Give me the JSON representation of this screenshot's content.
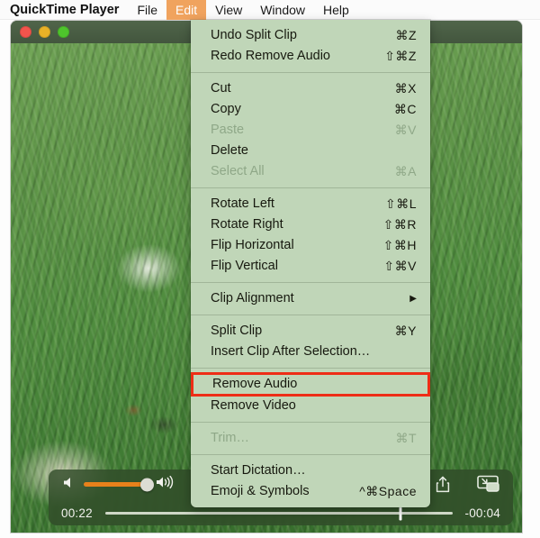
{
  "menubar": {
    "app_name": "QuickTime Player",
    "items": [
      {
        "label": "File",
        "active": false
      },
      {
        "label": "Edit",
        "active": true
      },
      {
        "label": "View",
        "active": false
      },
      {
        "label": "Window",
        "active": false
      },
      {
        "label": "Help",
        "active": false
      }
    ],
    "active_accent": "#f0a35e"
  },
  "window": {
    "traffic_lights": [
      {
        "name": "close",
        "color": "#f2544c"
      },
      {
        "name": "minimize",
        "color": "#e8b227"
      },
      {
        "name": "zoom",
        "color": "#4ec42c"
      }
    ]
  },
  "edit_menu": {
    "highlight_color": "#ee2d16",
    "background": "#c0d6b8",
    "groups": [
      {
        "items": [
          {
            "label": "Undo Split Clip",
            "shortcut": "⌘Z",
            "enabled": true,
            "highlighted": false,
            "submenu": false
          },
          {
            "label": "Redo Remove Audio",
            "shortcut": "⇧⌘Z",
            "enabled": true,
            "highlighted": false,
            "submenu": false
          }
        ]
      },
      {
        "items": [
          {
            "label": "Cut",
            "shortcut": "⌘X",
            "enabled": true,
            "highlighted": false,
            "submenu": false
          },
          {
            "label": "Copy",
            "shortcut": "⌘C",
            "enabled": true,
            "highlighted": false,
            "submenu": false
          },
          {
            "label": "Paste",
            "shortcut": "⌘V",
            "enabled": false,
            "highlighted": false,
            "submenu": false
          },
          {
            "label": "Delete",
            "shortcut": "",
            "enabled": true,
            "highlighted": false,
            "submenu": false
          },
          {
            "label": "Select All",
            "shortcut": "⌘A",
            "enabled": false,
            "highlighted": false,
            "submenu": false
          }
        ]
      },
      {
        "items": [
          {
            "label": "Rotate Left",
            "shortcut": "⇧⌘L",
            "enabled": true,
            "highlighted": false,
            "submenu": false
          },
          {
            "label": "Rotate Right",
            "shortcut": "⇧⌘R",
            "enabled": true,
            "highlighted": false,
            "submenu": false
          },
          {
            "label": "Flip Horizontal",
            "shortcut": "⇧⌘H",
            "enabled": true,
            "highlighted": false,
            "submenu": false
          },
          {
            "label": "Flip Vertical",
            "shortcut": "⇧⌘V",
            "enabled": true,
            "highlighted": false,
            "submenu": false
          }
        ]
      },
      {
        "items": [
          {
            "label": "Clip Alignment",
            "shortcut": "",
            "enabled": true,
            "highlighted": false,
            "submenu": true
          }
        ]
      },
      {
        "items": [
          {
            "label": "Split Clip",
            "shortcut": "⌘Y",
            "enabled": true,
            "highlighted": false,
            "submenu": false
          },
          {
            "label": "Insert Clip After Selection…",
            "shortcut": "",
            "enabled": true,
            "highlighted": false,
            "submenu": false
          }
        ]
      },
      {
        "items": [
          {
            "label": "Remove Audio",
            "shortcut": "",
            "enabled": true,
            "highlighted": true,
            "submenu": false
          },
          {
            "label": "Remove Video",
            "shortcut": "",
            "enabled": true,
            "highlighted": false,
            "submenu": false
          }
        ]
      },
      {
        "items": [
          {
            "label": "Trim…",
            "shortcut": "⌘T",
            "enabled": false,
            "highlighted": false,
            "submenu": false
          }
        ]
      },
      {
        "items": [
          {
            "label": "Start Dictation…",
            "shortcut": "",
            "enabled": true,
            "highlighted": false,
            "submenu": false
          },
          {
            "label": "Emoji & Symbols",
            "shortcut": "^⌘Space",
            "enabled": true,
            "highlighted": false,
            "submenu": false
          }
        ]
      }
    ]
  },
  "player": {
    "current_time": "00:22",
    "remaining_time": "-00:04",
    "volume_percent": 78,
    "progress_percent": 85,
    "volume_accent": "#e8811b",
    "icons": {
      "volume_min": "speaker-low-icon",
      "volume_max": "speaker-high-icon",
      "rewind": "rewind-icon",
      "pause": "pause-icon",
      "fast_forward": "fast-forward-icon",
      "share": "share-icon",
      "pip": "picture-in-picture-icon"
    }
  }
}
